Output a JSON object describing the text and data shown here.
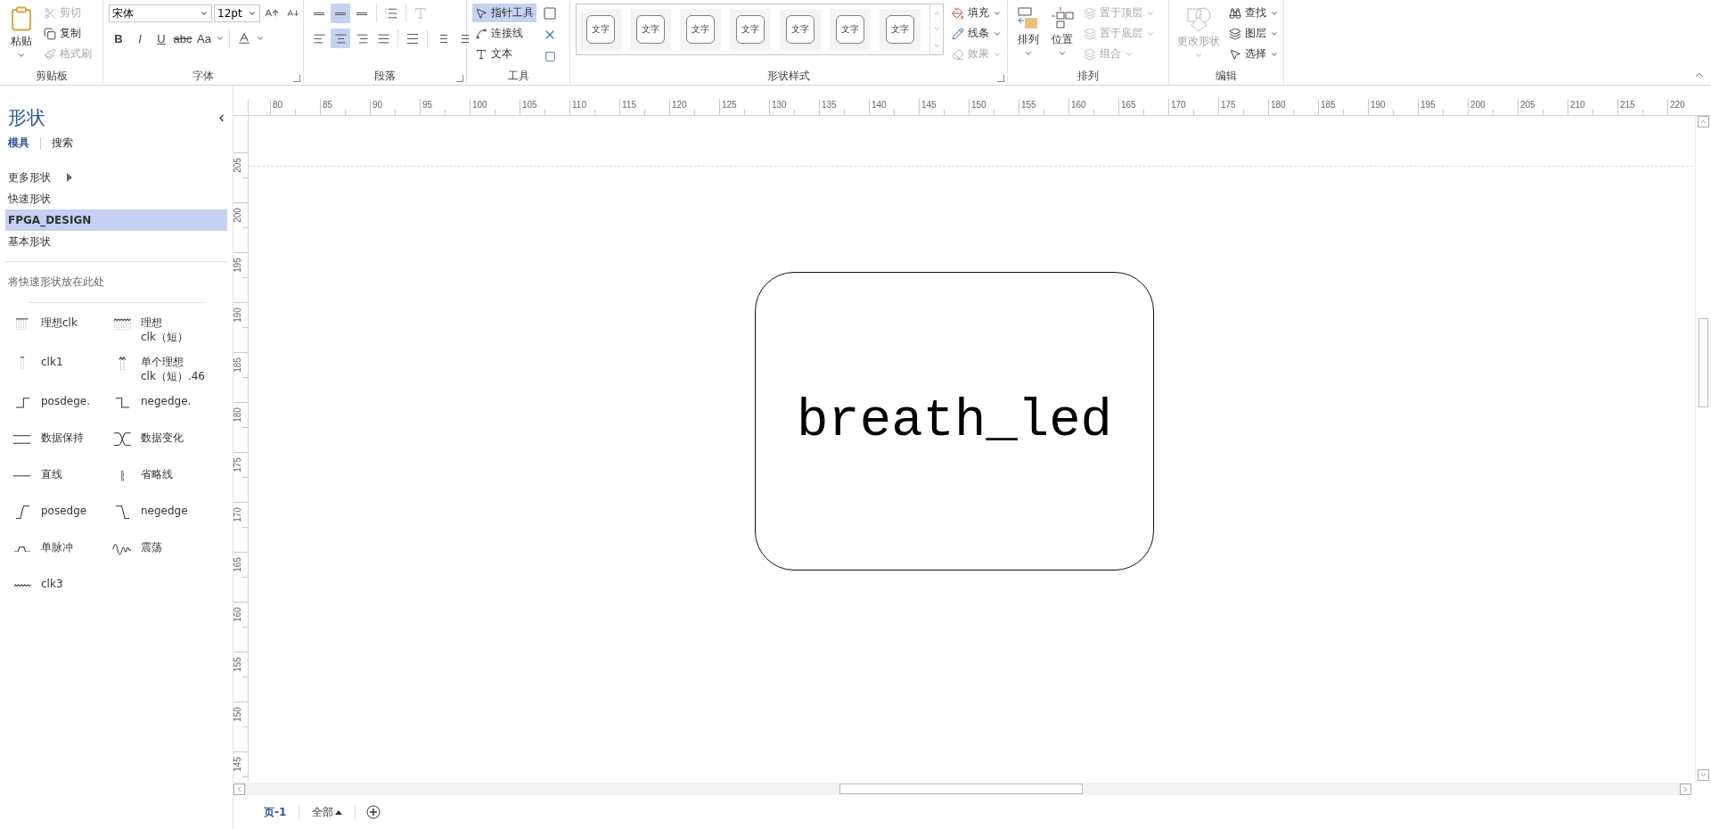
{
  "ribbon": {
    "clipboard": {
      "label": "剪贴板",
      "paste": "粘贴",
      "items": [
        {
          "label": "剪切",
          "disabled": true
        },
        {
          "label": "复制",
          "disabled": false
        },
        {
          "label": "格式刷",
          "disabled": true
        }
      ]
    },
    "font": {
      "label": "字体",
      "font_name": "宋体",
      "font_size": "12pt",
      "styles": [
        "B",
        "I",
        "U",
        "abc",
        "Aa"
      ]
    },
    "paragraph": {
      "label": "段落",
      "vertical_align": [
        {
          "selected": false
        },
        {
          "selected": true
        },
        {
          "selected": false
        }
      ],
      "horizontal_align": [
        {
          "selected": false
        },
        {
          "selected": true
        },
        {
          "selected": false
        },
        {
          "selected": false
        }
      ]
    },
    "tools": {
      "label": "工具",
      "items": [
        {
          "label": "指针工具",
          "selected": true
        },
        {
          "label": "连接线",
          "selected": false
        },
        {
          "label": "文本",
          "selected": false
        }
      ]
    },
    "shape_styles": {
      "label": "形状样式",
      "swatches": [
        "文字",
        "文字",
        "文字",
        "文字",
        "文字",
        "文字",
        "文字"
      ],
      "items": [
        {
          "label": "填充",
          "disabled": false
        },
        {
          "label": "线条",
          "disabled": false
        },
        {
          "label": "效果",
          "disabled": true
        }
      ]
    },
    "arrange": {
      "label": "排列",
      "large": [
        "排列",
        "位置"
      ],
      "items": [
        {
          "label": "置于顶层",
          "disabled": true
        },
        {
          "label": "置于底层",
          "disabled": true
        },
        {
          "label": "组合",
          "disabled": true
        }
      ]
    },
    "editing": {
      "label": "编辑",
      "change_shape": {
        "label": "更改形状",
        "disabled": true
      },
      "items": [
        "查找",
        "图层",
        "选择"
      ]
    }
  },
  "shapes_panel": {
    "title": "形状",
    "tabs": [
      {
        "label": "模具",
        "selected": true
      },
      {
        "label": "搜索",
        "selected": false
      }
    ],
    "stencils": [
      {
        "label": "更多形状",
        "submenu": true,
        "selected": false
      },
      {
        "label": "快速形状",
        "submenu": false,
        "selected": false
      },
      {
        "label": "FPGA_DESIGN",
        "submenu": false,
        "selected": true
      },
      {
        "label": "基本形状",
        "submenu": false,
        "selected": false
      }
    ],
    "hint": "将快速形状放在此处",
    "masters": [
      {
        "label": "理想clk",
        "kind": "ideal-clk"
      },
      {
        "label": "理想\nclk（短）",
        "kind": "ideal-clk-short"
      },
      {
        "label": "clk1",
        "kind": "clk1"
      },
      {
        "label": "单个理想\nclk（短）.46",
        "kind": "single-clk"
      },
      {
        "label": "posdege.",
        "kind": "step-up"
      },
      {
        "label": "negedge.",
        "kind": "step-down"
      },
      {
        "label": "数据保持",
        "kind": "hold"
      },
      {
        "label": "数据变化",
        "kind": "change"
      },
      {
        "label": "直线",
        "kind": "line"
      },
      {
        "label": "省略线",
        "kind": "ellipsis"
      },
      {
        "label": "posedge",
        "kind": "posedge"
      },
      {
        "label": "negedge",
        "kind": "negedge"
      },
      {
        "label": "单脉冲",
        "kind": "pulse"
      },
      {
        "label": "震荡",
        "kind": "oscillation"
      },
      {
        "label": "clk3",
        "kind": "clk3"
      }
    ]
  },
  "horizontal_ruler": [
    "80",
    "85",
    "90",
    "95",
    "100",
    "105",
    "110",
    "115",
    "120",
    "125",
    "130",
    "135",
    "140",
    "145",
    "150",
    "155",
    "160",
    "165",
    "170",
    "175",
    "180",
    "185",
    "190",
    "195",
    "200",
    "205",
    "210",
    "215",
    "220"
  ],
  "vertical_ruler": [
    "205",
    "200",
    "195",
    "190",
    "185",
    "180",
    "175",
    "170",
    "165",
    "160",
    "155",
    "150",
    "145"
  ],
  "canvas": {
    "shapes": [
      {
        "kind": "rounded-rectangle",
        "text": "breath_led"
      }
    ]
  },
  "page_tabs": {
    "pages": [
      {
        "label": "页-1",
        "selected": true
      }
    ],
    "all_pages": "全部"
  }
}
